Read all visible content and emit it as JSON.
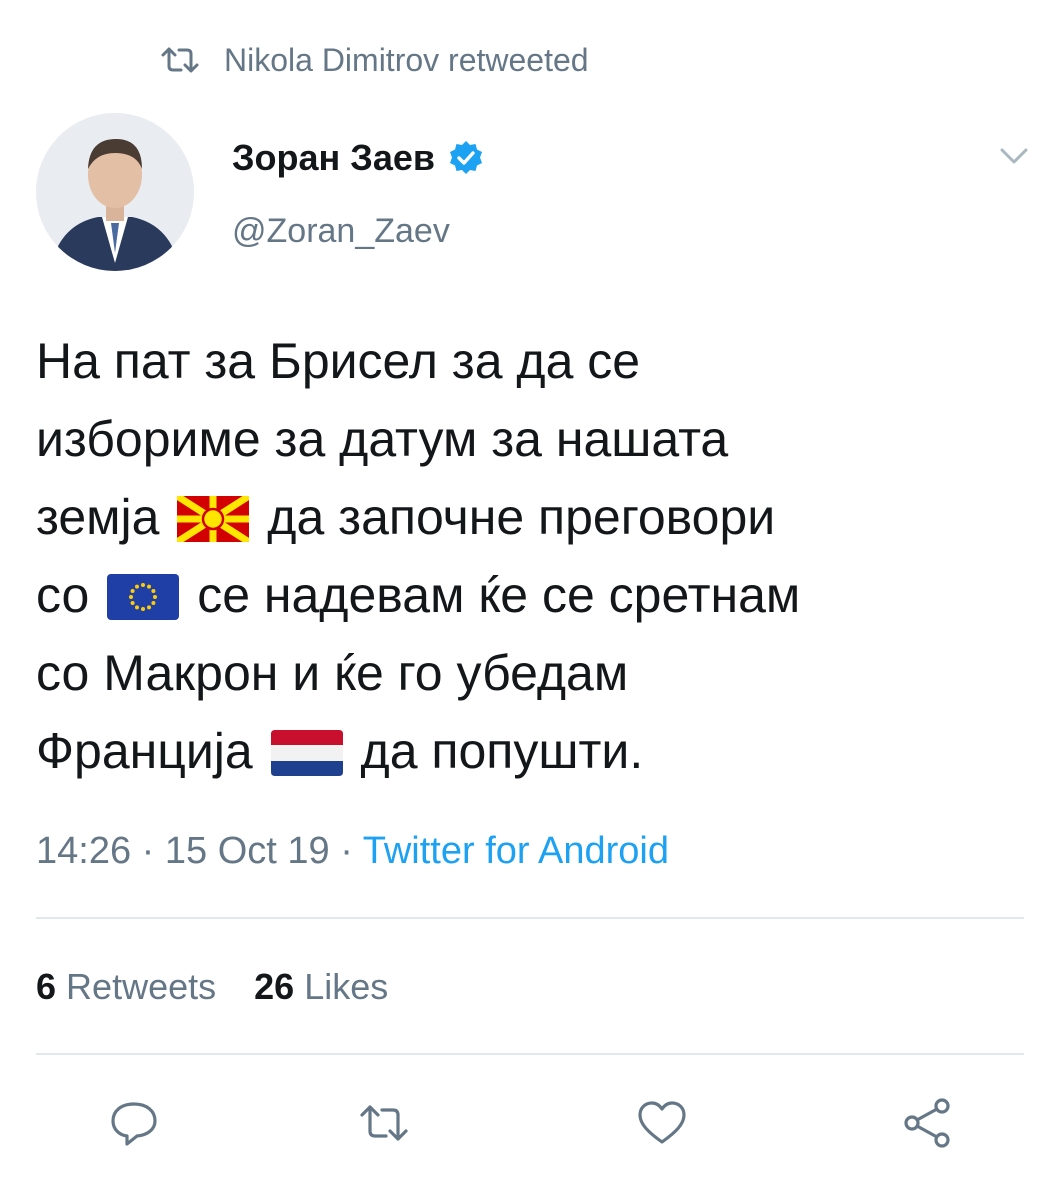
{
  "retweet_header": {
    "icon": "retweet-icon",
    "text": "Nikola Dimitrov retweeted"
  },
  "author": {
    "display_name": "Зоран Заев",
    "handle": "@Zoran_Zaev",
    "verified_icon": "verified-badge-icon",
    "avatar": "profile-photo"
  },
  "menu_icon": "chevron-down-icon",
  "tweet": {
    "segments": {
      "l1": "На пат за Брисел за да се",
      "l2": "избориме за датум за нашата",
      "l3a": "земја",
      "l3b": "да започне преговори",
      "l4a": "со",
      "l4b": "се надевам ќе се сретнам",
      "l5": "со Макрон и ќе го убедам",
      "l6a": "Франција",
      "l6b": "да попушти."
    },
    "emoji": [
      "flag-north-macedonia",
      "flag-european-union",
      "flag-netherlands"
    ],
    "time": "14:26",
    "date": "15 Oct 19",
    "separator": "·",
    "source": "Twitter for Android"
  },
  "stats": {
    "retweets_count": "6",
    "retweets_label": "Retweets",
    "likes_count": "26",
    "likes_label": "Likes"
  },
  "actions": [
    "reply-icon",
    "retweet-icon",
    "like-icon",
    "share-icon"
  ],
  "colors": {
    "accent": "#1da1f2",
    "secondary_text": "#657786",
    "divider": "#e1e8ed"
  }
}
